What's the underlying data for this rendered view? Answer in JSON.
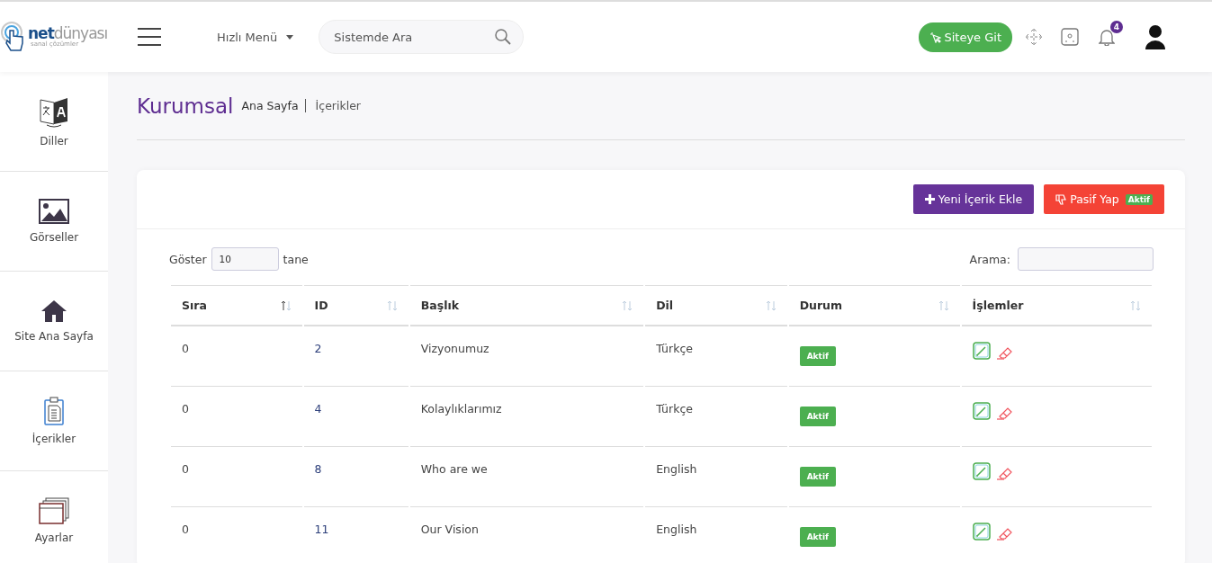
{
  "logo": {
    "brand_bold": "net",
    "brand_light": "dünyası",
    "tagline": "sanal çözümler"
  },
  "header": {
    "quick_menu": "Hızlı Menü",
    "search": {
      "placeholder": "Sistemde Ara"
    },
    "site_button": "Siteye Git",
    "notification_count": "4"
  },
  "sidebar": {
    "items": [
      {
        "label": "Diller",
        "kind": "languages"
      },
      {
        "label": "Görseller",
        "kind": "images"
      },
      {
        "label": "Site Ana Sayfa",
        "kind": "home"
      },
      {
        "label": "İçerikler",
        "kind": "contents"
      },
      {
        "label": "Ayarlar",
        "kind": "settings"
      }
    ]
  },
  "page": {
    "title": "Kurumsal",
    "breadcrumb": [
      "Ana Sayfa",
      "İçerikler"
    ]
  },
  "toolbar": {
    "add_button": "Yeni İçerik Ekle",
    "passive_button": "Pasif Yap",
    "passive_badge": "Aktif"
  },
  "table_controls": {
    "show_label": "Göster",
    "page_size": "10",
    "show_suffix": "tane",
    "search_label": "Arama:"
  },
  "table": {
    "columns": [
      {
        "label": "Sıra",
        "sorted": true
      },
      {
        "label": "ID",
        "sorted": false
      },
      {
        "label": "Başlık",
        "sorted": false
      },
      {
        "label": "Dil",
        "sorted": false
      },
      {
        "label": "Durum",
        "sorted": false
      },
      {
        "label": "İşlemler",
        "sorted": false
      }
    ],
    "rows": [
      {
        "order": "0",
        "id": "2",
        "title": "Vizyonumuz",
        "language": "Türkçe",
        "status": "Aktif",
        "active": true
      },
      {
        "order": "0",
        "id": "4",
        "title": "Kolaylıklarımız",
        "language": "Türkçe",
        "status": "Aktif",
        "active": true
      },
      {
        "order": "0",
        "id": "8",
        "title": "Who are we",
        "language": "English",
        "status": "Aktif",
        "active": true
      },
      {
        "order": "0",
        "id": "11",
        "title": "Our Vision",
        "language": "English",
        "status": "Aktif",
        "active": true
      }
    ]
  }
}
